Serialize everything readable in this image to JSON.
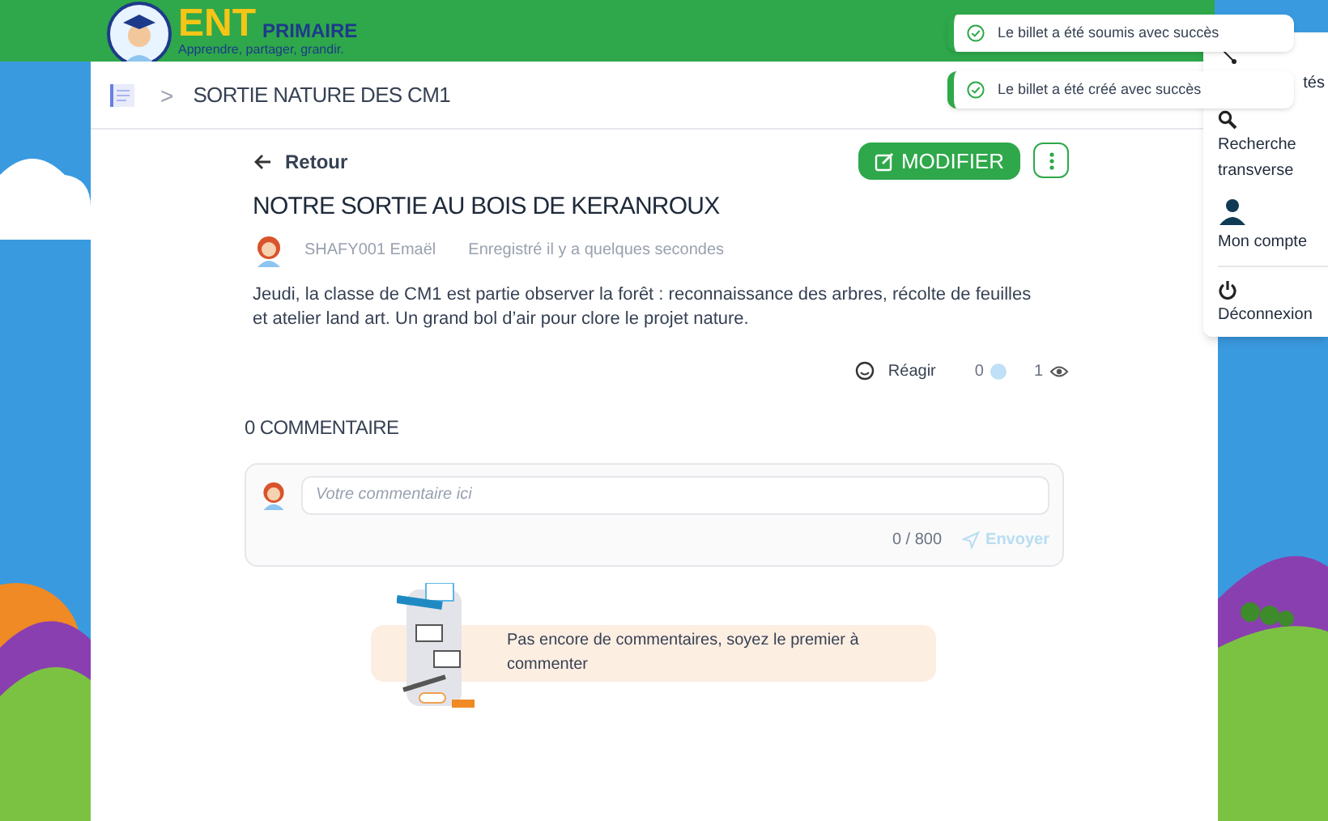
{
  "header": {
    "logo_letters": "ENT",
    "logo_word": "PRIMAIRE",
    "tagline": "Apprendre, partager, grandir."
  },
  "breadcrumb": {
    "separator": ">",
    "title": "SORTIE NATURE DES CM1"
  },
  "toasts": [
    {
      "message": "Le billet a été soumis avec succès"
    },
    {
      "message": "Le billet a été créé avec succès"
    }
  ],
  "side_menu": {
    "items": [
      {
        "kind": "network",
        "label": "tés"
      },
      {
        "kind": "search",
        "label": "Recherche transverse"
      },
      {
        "kind": "account",
        "label": "Mon compte"
      },
      {
        "kind": "logout",
        "label": "Déconnexion"
      }
    ]
  },
  "post": {
    "back": "Retour",
    "edit_button": "MODIFIER",
    "title": "NOTRE SORTIE AU BOIS DE KERANROUX",
    "author": "SHAFY001 Emaël",
    "saved": "Enregistré il y a quelques secondes",
    "body": "Jeudi, la classe de CM1 est partie observer la forêt : reconnaissance des arbres, récolte de feuilles et atelier land art. Un grand bol d’air pour clore le projet nature.",
    "react": "Réagir",
    "reactions": "0",
    "views": "1"
  },
  "comments": {
    "heading": "0 COMMENTAIRE",
    "placeholder": "Votre commentaire ici",
    "counter": "0 / 800",
    "send": "Envoyer",
    "empty_message": "Pas encore de commentaires, soyez le premier à commenter"
  }
}
